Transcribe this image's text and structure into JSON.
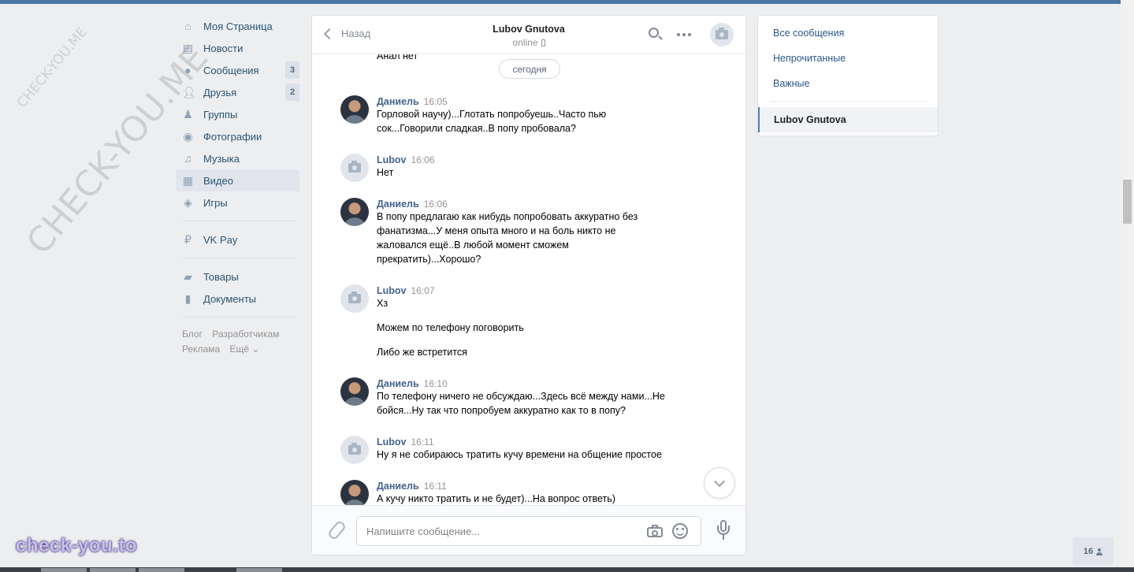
{
  "nav": {
    "items": [
      {
        "label": "Моя Страница",
        "icon": "home-icon"
      },
      {
        "label": "Новости",
        "icon": "news-icon"
      },
      {
        "label": "Сообщения",
        "icon": "messages-icon",
        "count": "3"
      },
      {
        "label": "Друзья",
        "icon": "friends-icon",
        "count": "2"
      },
      {
        "label": "Группы",
        "icon": "groups-icon"
      },
      {
        "label": "Фотографии",
        "icon": "photos-icon"
      },
      {
        "label": "Музыка",
        "icon": "music-icon"
      },
      {
        "label": "Видео",
        "icon": "video-icon",
        "active": true
      },
      {
        "label": "Игры",
        "icon": "games-icon"
      }
    ],
    "pay": {
      "label": "VK Pay",
      "icon": "vkpay-icon"
    },
    "extra": [
      {
        "label": "Товары",
        "icon": "goods-icon"
      },
      {
        "label": "Документы",
        "icon": "documents-icon"
      }
    ],
    "footer": {
      "blog": "Блог",
      "dev": "Разработчикам",
      "ads": "Реклама",
      "more": "Ещё ⌄"
    }
  },
  "chat": {
    "back_label": "Назад",
    "peer_name": "Lubov Gnutova",
    "peer_status": "online",
    "prev_line": "Анал нет",
    "date_label": "сегодня",
    "messages": [
      {
        "author": "Даниель",
        "time": "16:05",
        "avatar": "photo",
        "texts": [
          "Горловой научу)...Глотать попробуешь..Часто пью\nсок...Говорили сладкая..В попу пробовала?"
        ]
      },
      {
        "author": "Lubov",
        "time": "16:06",
        "avatar": "empty",
        "texts": [
          "Нет"
        ]
      },
      {
        "author": "Даниель",
        "time": "16:06",
        "avatar": "photo",
        "texts": [
          "В попу предлагаю как нибудь попробовать аккуратно без\nфанатизма...У меня опыта много и на боль никто не\nжаловался ещё..В любой момент сможем\nпрекратить)...Хорошо?"
        ]
      },
      {
        "author": "Lubov",
        "time": "16:07",
        "avatar": "empty",
        "texts": [
          "Хз",
          "Можем по телефону поговорить",
          "Либо же встретится"
        ]
      },
      {
        "author": "Даниель",
        "time": "16:10",
        "avatar": "photo",
        "texts": [
          "По телефону ничего не обсуждаю...Здесь всё между нами...Не\nбойся...Ну так что попробуем аккуратно как то в попу?"
        ]
      },
      {
        "author": "Lubov",
        "time": "16:11",
        "avatar": "empty",
        "texts": [
          "Ну я не собираюсь тратить кучу времени на общение простое"
        ]
      },
      {
        "author": "Даниель",
        "time": "16:11",
        "avatar": "photo",
        "texts": [
          "А кучу никто тратить и не будет)...На вопрос ответь)"
        ]
      }
    ],
    "composer_placeholder": "Напишите сообщение..."
  },
  "filters": {
    "all": "Все сообщения",
    "unread": "Непрочитанные",
    "important": "Важные",
    "selected": "Lubov Gnutova"
  },
  "friends_online": "16",
  "watermarks": {
    "small": "CHECK-YOU.ME",
    "large": "CHECK-YOU.ME",
    "logo": "check-you.to"
  },
  "colors": {
    "accent": "#4a76a8",
    "link": "#2a5885",
    "author": "#42648b",
    "background": "#edeef0"
  }
}
